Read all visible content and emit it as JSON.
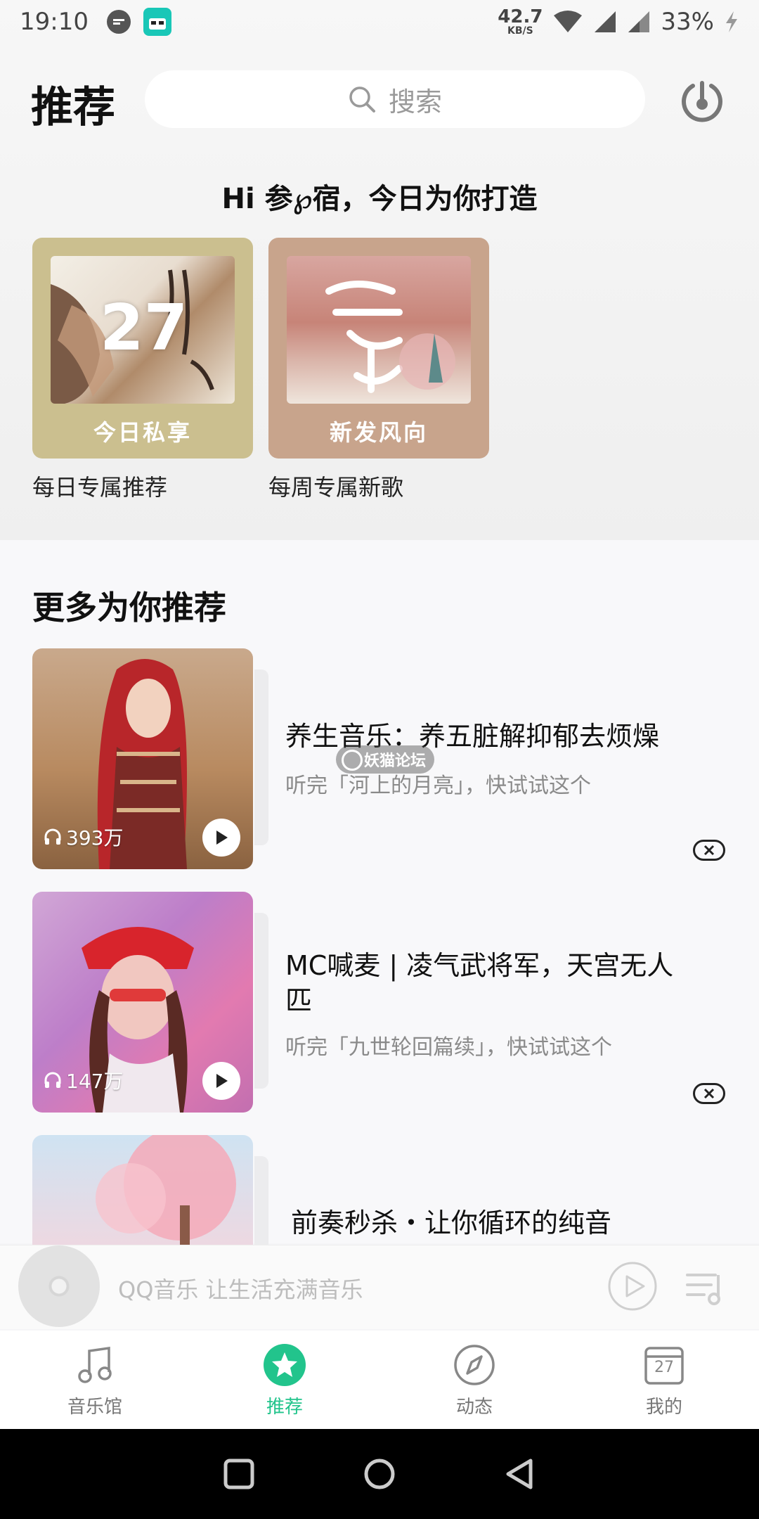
{
  "status_bar": {
    "time": "19:10",
    "net_speed_value": "42.7",
    "net_speed_unit": "KB/S",
    "battery": "33%",
    "app_icon_label": "MAGIC"
  },
  "header": {
    "title": "推荐",
    "search_placeholder": "搜索"
  },
  "greeting": "Hi 参℘宿，今日为你打造",
  "daily_cards": [
    {
      "art_number": "27",
      "ribbon": "今日私享",
      "caption": "每日专属推荐"
    },
    {
      "ribbon": "新发风向",
      "caption": "每周专属新歌"
    }
  ],
  "section_title": "更多为你推荐",
  "playlists": [
    {
      "title": "养生音乐：养五脏解抑郁去烦燥",
      "desc": "听完「河上的月亮」，快试试这个",
      "plays": "393万"
    },
    {
      "title": "MC喊麦 | 凌气武将军，天宫无人匹",
      "desc": "听完「九世轮回篇续」，快试试这个",
      "plays": "147万"
    },
    {
      "title": "前奏秒杀・让你循环的纯音",
      "desc": "",
      "plays": ""
    }
  ],
  "watermark": "妖猫论坛",
  "mini_player": {
    "text": "QQ音乐 让生活充满音乐"
  },
  "tabs": [
    {
      "label": "音乐馆",
      "icon": "music-note-icon",
      "active": false
    },
    {
      "label": "推荐",
      "icon": "star-icon",
      "active": true
    },
    {
      "label": "动态",
      "icon": "compass-icon",
      "active": false
    },
    {
      "label": "我的",
      "icon": "calendar-icon",
      "active": false,
      "icon_text": "27"
    }
  ],
  "colors": {
    "accent": "#22c48c",
    "card1": "#cbbf8f",
    "card2": "#c8a48c"
  }
}
